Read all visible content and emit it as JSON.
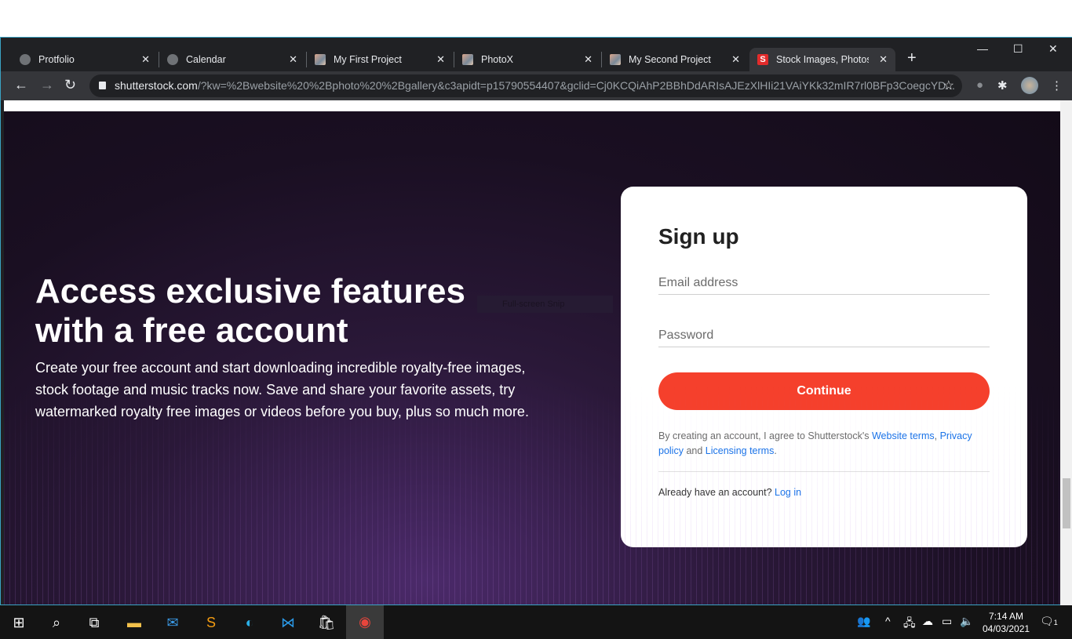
{
  "browser": {
    "tabs": [
      {
        "label": "Protfolio",
        "icon": "globe-icon"
      },
      {
        "label": "Calendar",
        "icon": "globe-icon"
      },
      {
        "label": "My First Project",
        "icon": "project-thumbnail-icon"
      },
      {
        "label": "PhotoX",
        "icon": "project-thumbnail-icon"
      },
      {
        "label": "My Second Project",
        "icon": "project-thumbnail-icon"
      },
      {
        "label": "Stock Images, Photos, V",
        "icon": "shutterstock-icon",
        "active": true
      }
    ],
    "url_host": "shutterstock.com",
    "url_rest": "/?kw=%2Bwebsite%20%2Bphoto%20%2Bgallery&c3apidt=p15790554407&gclid=Cj0KCQiAhP2BBhDdARIsAJEzXlHIi21VAiYKk32mIR7rl0BFp3CoegcYD..."
  },
  "hero": {
    "title": "Access exclusive features with a free account",
    "subtitle": "Create your free account and start downloading incredible royalty-free images, stock footage and music tracks now. Save and share your favorite assets, try watermarked royalty free images or videos before you buy, plus so much more.",
    "snip_label": "Full-screen Snip"
  },
  "signup": {
    "title": "Sign up",
    "email_placeholder": "Email address",
    "password_placeholder": "Password",
    "continue": "Continue",
    "terms_prefix": "By creating an account, I agree to Shutterstock's ",
    "website_terms": "Website terms",
    "comma": ", ",
    "privacy": "Privacy policy",
    "and": " and ",
    "licensing": "Licensing terms",
    "period": ".",
    "login_prompt": "Already have an account? ",
    "login_link": "Log in"
  },
  "taskbar": {
    "time": "7:14 AM",
    "date": "04/03/2021",
    "notifications": "1"
  },
  "colors": {
    "accent": "#f5402c",
    "link": "#1a73e8"
  }
}
